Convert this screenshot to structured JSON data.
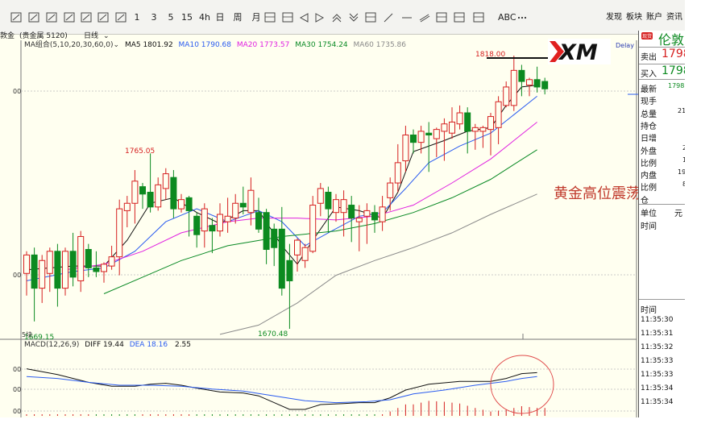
{
  "toolbar": {
    "tools": [
      "1",
      "3",
      "5",
      "15",
      "4h",
      "日",
      "周",
      "月",
      "ABC"
    ],
    "menus": [
      "发现",
      "板块",
      "账户",
      "资讯"
    ]
  },
  "subbar": {
    "symbol": "敦金",
    "group": "(贵金属 5120)",
    "period": "日线",
    "ma_label": "MA组合(5,10,20,30,60,0)",
    "ma5": "MA5 1801.92",
    "ma10": "MA10 1790.68",
    "ma20": "MA20 1773.57",
    "ma30": "MA30 1754.24",
    "ma60": "MA60 1735.86",
    "delay": "Delay"
  },
  "macd_header": {
    "label": "MACD(12,26,9)",
    "diff": "DIFF 19.44",
    "dea": "DEA 18.16",
    "macd": "2.55"
  },
  "colors": {
    "up": "#d62020",
    "down": "#0c8a20",
    "ma5": "#111111",
    "ma10": "#2b5cf0",
    "ma20": "#e020e0",
    "ma30": "#0a8a25",
    "ma60": "#8a8a8a",
    "diff": "#111111",
    "dea": "#2b5cf0",
    "annotation": "#c0392b"
  },
  "annotations": {
    "headline": "黄金高位震荡",
    "partial_label": "5块",
    "logo": "XM"
  },
  "right_panel": {
    "title": "伦敦",
    "badge": "现货",
    "sell_label": "卖出",
    "sell_value": "1798",
    "buy_label": "买入",
    "buy_value": "1798",
    "rows": [
      {
        "label": "最新",
        "value": "1798"
      },
      {
        "label": "现手",
        "value": ""
      },
      {
        "label": "总量",
        "value": "21"
      },
      {
        "label": "持仓",
        "value": ""
      },
      {
        "label": "日增",
        "value": ""
      },
      {
        "label": "外盘",
        "value": "2"
      },
      {
        "label": "比例",
        "value": "1"
      },
      {
        "label": "内盘",
        "value": "19"
      },
      {
        "label": "比例",
        "value": "8"
      },
      {
        "label": "仓",
        "value": ""
      }
    ],
    "col1": "单位",
    "col2": "元",
    "time_label": "时间",
    "time_header": "时间",
    "times": [
      "11:35:30",
      "11:35:31",
      "11:35:32",
      "11:35:33",
      "11:35:33",
      "11:35:34",
      "11:35:34"
    ]
  },
  "chart_data": {
    "type": "candlestick",
    "title": "",
    "ylim": [
      1665,
      1825
    ],
    "y_tick_labels": [
      "00",
      "00"
    ],
    "macd_tick_labels": [
      "00",
      "00",
      "00"
    ],
    "price_labels": {
      "high": "1818.00",
      "mid_high": "1765.05",
      "low": "1670.48",
      "left_low": "1669.15"
    },
    "candles": [
      {
        "o": 1700,
        "c": 1710,
        "h": 1712,
        "l": 1688
      },
      {
        "o": 1710,
        "c": 1692,
        "h": 1714,
        "l": 1674
      },
      {
        "o": 1692,
        "c": 1707,
        "h": 1710,
        "l": 1684
      },
      {
        "o": 1700,
        "c": 1712,
        "h": 1714,
        "l": 1690
      },
      {
        "o": 1712,
        "c": 1692,
        "h": 1716,
        "l": 1682
      },
      {
        "o": 1692,
        "c": 1712,
        "h": 1714,
        "l": 1688
      },
      {
        "o": 1712,
        "c": 1698,
        "h": 1722,
        "l": 1693
      },
      {
        "o": 1696,
        "c": 1720,
        "h": 1723,
        "l": 1690
      },
      {
        "o": 1713,
        "c": 1703,
        "h": 1716,
        "l": 1698
      },
      {
        "o": 1703,
        "c": 1701,
        "h": 1712,
        "l": 1698
      },
      {
        "o": 1701,
        "c": 1705,
        "h": 1706,
        "l": 1695
      },
      {
        "o": 1704,
        "c": 1709,
        "h": 1715,
        "l": 1702
      },
      {
        "o": 1709,
        "c": 1735,
        "h": 1740,
        "l": 1699
      },
      {
        "o": 1734,
        "c": 1738,
        "h": 1742,
        "l": 1725
      },
      {
        "o": 1738,
        "c": 1750,
        "h": 1756,
        "l": 1727
      },
      {
        "o": 1747,
        "c": 1743,
        "h": 1749,
        "l": 1735
      },
      {
        "o": 1744,
        "c": 1736,
        "h": 1765,
        "l": 1733
      },
      {
        "o": 1736,
        "c": 1748,
        "h": 1752,
        "l": 1734
      },
      {
        "o": 1746,
        "c": 1754,
        "h": 1757,
        "l": 1740
      },
      {
        "o": 1752,
        "c": 1735,
        "h": 1756,
        "l": 1730
      },
      {
        "o": 1735,
        "c": 1740,
        "h": 1743,
        "l": 1733
      },
      {
        "o": 1741,
        "c": 1734,
        "h": 1742,
        "l": 1720
      },
      {
        "o": 1731,
        "c": 1721,
        "h": 1733,
        "l": 1714
      },
      {
        "o": 1723,
        "c": 1735,
        "h": 1738,
        "l": 1714
      },
      {
        "o": 1726,
        "c": 1723,
        "h": 1730,
        "l": 1711
      },
      {
        "o": 1723,
        "c": 1732,
        "h": 1738,
        "l": 1720
      },
      {
        "o": 1728,
        "c": 1731,
        "h": 1741,
        "l": 1722
      },
      {
        "o": 1730,
        "c": 1738,
        "h": 1743,
        "l": 1727
      },
      {
        "o": 1738,
        "c": 1736,
        "h": 1747,
        "l": 1732
      },
      {
        "o": 1733,
        "c": 1745,
        "h": 1752,
        "l": 1726
      },
      {
        "o": 1733,
        "c": 1724,
        "h": 1741,
        "l": 1722
      },
      {
        "o": 1733,
        "c": 1713,
        "h": 1735,
        "l": 1705
      },
      {
        "o": 1724,
        "c": 1714,
        "h": 1727,
        "l": 1704
      },
      {
        "o": 1724,
        "c": 1692,
        "h": 1736,
        "l": 1688
      },
      {
        "o": 1707,
        "c": 1696,
        "h": 1716,
        "l": 1670
      },
      {
        "o": 1710,
        "c": 1718,
        "h": 1719,
        "l": 1701
      },
      {
        "o": 1707,
        "c": 1714,
        "h": 1716,
        "l": 1703
      },
      {
        "o": 1712,
        "c": 1737,
        "h": 1742,
        "l": 1711
      },
      {
        "o": 1738,
        "c": 1746,
        "h": 1749,
        "l": 1731
      },
      {
        "o": 1744,
        "c": 1735,
        "h": 1747,
        "l": 1722
      },
      {
        "o": 1733,
        "c": 1740,
        "h": 1743,
        "l": 1728
      },
      {
        "o": 1733,
        "c": 1740,
        "h": 1745,
        "l": 1720
      },
      {
        "o": 1737,
        "c": 1730,
        "h": 1742,
        "l": 1717
      },
      {
        "o": 1728,
        "c": 1730,
        "h": 1737,
        "l": 1712
      },
      {
        "o": 1731,
        "c": 1734,
        "h": 1738,
        "l": 1716
      },
      {
        "o": 1733,
        "c": 1729,
        "h": 1737,
        "l": 1722
      },
      {
        "o": 1728,
        "c": 1736,
        "h": 1742,
        "l": 1723
      },
      {
        "o": 1741,
        "c": 1749,
        "h": 1752,
        "l": 1734
      },
      {
        "o": 1749,
        "c": 1760,
        "h": 1770,
        "l": 1744
      },
      {
        "o": 1761,
        "c": 1775,
        "h": 1780,
        "l": 1755
      },
      {
        "o": 1775,
        "c": 1771,
        "h": 1778,
        "l": 1765
      },
      {
        "o": 1771,
        "c": 1777,
        "h": 1780,
        "l": 1765
      },
      {
        "o": 1776,
        "c": 1775,
        "h": 1782,
        "l": 1755
      },
      {
        "o": 1773,
        "c": 1778,
        "h": 1779,
        "l": 1763
      },
      {
        "o": 1777,
        "c": 1781,
        "h": 1784,
        "l": 1761
      },
      {
        "o": 1776,
        "c": 1782,
        "h": 1790,
        "l": 1773
      },
      {
        "o": 1781,
        "c": 1787,
        "h": 1791,
        "l": 1778
      },
      {
        "o": 1787,
        "c": 1777,
        "h": 1790,
        "l": 1765
      },
      {
        "o": 1777,
        "c": 1779,
        "h": 1781,
        "l": 1767
      },
      {
        "o": 1777,
        "c": 1779,
        "h": 1780,
        "l": 1768
      },
      {
        "o": 1778,
        "c": 1785,
        "h": 1787,
        "l": 1764
      },
      {
        "o": 1779,
        "c": 1793,
        "h": 1796,
        "l": 1770
      },
      {
        "o": 1791,
        "c": 1801,
        "h": 1804,
        "l": 1790
      },
      {
        "o": 1791,
        "c": 1810,
        "h": 1818,
        "l": 1788
      },
      {
        "o": 1810,
        "c": 1804,
        "h": 1813,
        "l": 1796
      },
      {
        "o": 1802,
        "c": 1805,
        "h": 1806,
        "l": 1796
      },
      {
        "o": 1805,
        "c": 1801,
        "h": 1812,
        "l": 1798
      },
      {
        "o": 1804,
        "c": 1800,
        "h": 1806,
        "l": 1797
      }
    ],
    "ma": {
      "ma5": [
        [
          0,
          1702
        ],
        [
          6,
          1704
        ],
        [
          10,
          1704
        ],
        [
          13,
          1718
        ],
        [
          16,
          1738
        ],
        [
          19,
          1741
        ],
        [
          22,
          1733
        ],
        [
          25,
          1727
        ],
        [
          28,
          1734
        ],
        [
          30,
          1734
        ],
        [
          33,
          1715
        ],
        [
          35,
          1705
        ],
        [
          37,
          1718
        ],
        [
          40,
          1736
        ],
        [
          43,
          1734
        ],
        [
          46,
          1730
        ],
        [
          48,
          1744
        ],
        [
          50,
          1766
        ],
        [
          54,
          1772
        ],
        [
          57,
          1777
        ],
        [
          60,
          1779
        ],
        [
          62,
          1791
        ],
        [
          64,
          1801
        ],
        [
          66,
          1802
        ]
      ],
      "ma10": [
        [
          0,
          1696
        ],
        [
          6,
          1701
        ],
        [
          10,
          1703
        ],
        [
          14,
          1712
        ],
        [
          18,
          1728
        ],
        [
          22,
          1735
        ],
        [
          26,
          1728
        ],
        [
          30,
          1734
        ],
        [
          33,
          1728
        ],
        [
          36,
          1715
        ],
        [
          39,
          1722
        ],
        [
          43,
          1731
        ],
        [
          46,
          1733
        ],
        [
          49,
          1746
        ],
        [
          52,
          1760
        ],
        [
          56,
          1769
        ],
        [
          60,
          1776
        ],
        [
          63,
          1786
        ],
        [
          66,
          1796
        ]
      ],
      "ma20": [
        [
          5,
          1702
        ],
        [
          10,
          1705
        ],
        [
          15,
          1712
        ],
        [
          20,
          1722
        ],
        [
          26,
          1728
        ],
        [
          30,
          1730
        ],
        [
          35,
          1730
        ],
        [
          40,
          1729
        ],
        [
          45,
          1731
        ],
        [
          50,
          1737
        ],
        [
          55,
          1749
        ],
        [
          60,
          1762
        ],
        [
          63,
          1772
        ],
        [
          66,
          1782
        ]
      ],
      "ma30": [
        [
          10,
          1689
        ],
        [
          15,
          1698
        ],
        [
          20,
          1707
        ],
        [
          26,
          1715
        ],
        [
          33,
          1720
        ],
        [
          40,
          1723
        ],
        [
          45,
          1727
        ],
        [
          50,
          1733
        ],
        [
          55,
          1741
        ],
        [
          60,
          1751
        ],
        [
          63,
          1759
        ],
        [
          66,
          1767
        ]
      ],
      "ma60": [
        [
          25,
          1667
        ],
        [
          30,
          1672
        ],
        [
          35,
          1684
        ],
        [
          40,
          1699
        ],
        [
          45,
          1707
        ],
        [
          50,
          1714
        ],
        [
          55,
          1722
        ],
        [
          60,
          1732
        ],
        [
          66,
          1743
        ]
      ]
    },
    "macd": {
      "diff": [
        [
          0,
          22
        ],
        [
          4,
          16
        ],
        [
          8,
          8
        ],
        [
          11,
          4
        ],
        [
          14,
          4
        ],
        [
          16,
          6
        ],
        [
          18,
          7
        ],
        [
          20,
          5
        ],
        [
          22,
          2
        ],
        [
          25,
          -2
        ],
        [
          28,
          -3
        ],
        [
          30,
          -6
        ],
        [
          32,
          -13
        ],
        [
          34,
          -20
        ],
        [
          36,
          -20
        ],
        [
          38,
          -15
        ],
        [
          41,
          -14
        ],
        [
          43,
          -13
        ],
        [
          45,
          -13
        ],
        [
          47,
          -8
        ],
        [
          49,
          0
        ],
        [
          52,
          6
        ],
        [
          56,
          9
        ],
        [
          60,
          9
        ],
        [
          62,
          12
        ],
        [
          64,
          17
        ],
        [
          66,
          18
        ]
      ],
      "dea": [
        [
          0,
          14
        ],
        [
          4,
          12
        ],
        [
          8,
          8
        ],
        [
          12,
          5
        ],
        [
          16,
          5
        ],
        [
          20,
          4
        ],
        [
          24,
          1
        ],
        [
          28,
          -1
        ],
        [
          32,
          -6
        ],
        [
          36,
          -11
        ],
        [
          40,
          -13
        ],
        [
          44,
          -12
        ],
        [
          47,
          -10
        ],
        [
          50,
          -4
        ],
        [
          54,
          0
        ],
        [
          58,
          5
        ],
        [
          62,
          9
        ],
        [
          64,
          12
        ],
        [
          66,
          14
        ]
      ],
      "ylim": [
        -22,
        28
      ],
      "bars_visible_from": 47
    }
  }
}
